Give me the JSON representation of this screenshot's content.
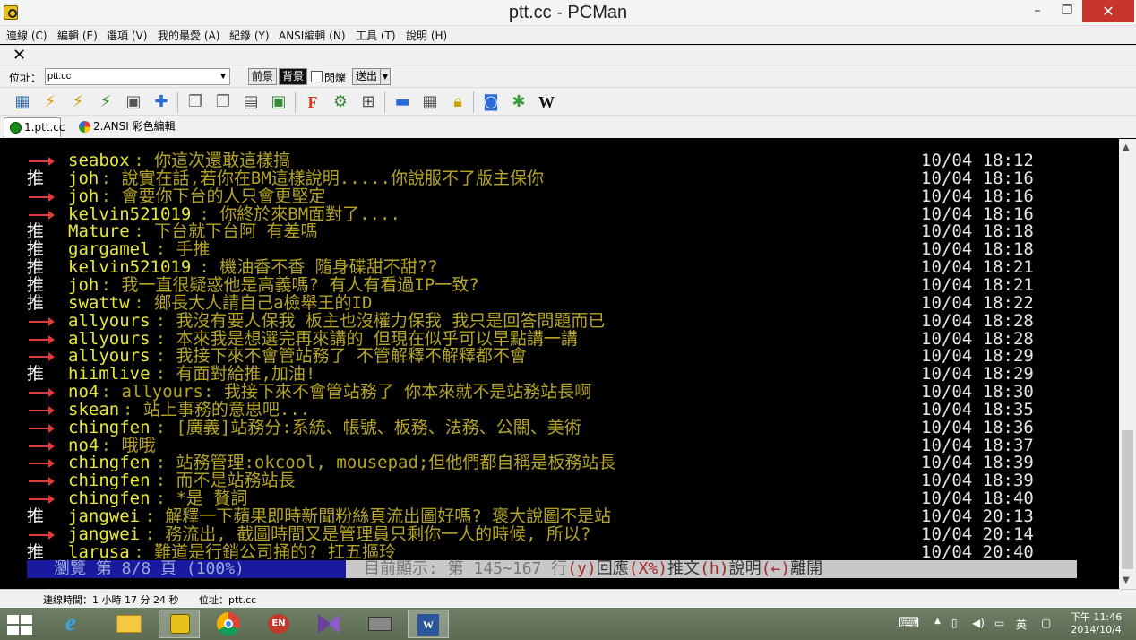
{
  "window": {
    "title": "ptt.cc - PCMan",
    "min": "–",
    "max": "❐",
    "close": "✕"
  },
  "menu": [
    "連線 (C)",
    "編輯 (E)",
    "選項 (V)",
    "我的最愛 (A)",
    "紀錄 (Y)",
    "ANSI編輯 (N)",
    "工具 (T)",
    "說明 (H)"
  ],
  "closebar": {
    "close_glyph": "✕"
  },
  "address": {
    "label": "位址：",
    "value": "ptt.cc",
    "fg_label": "前景",
    "bg_label": "背景",
    "blink_label": "閃爍",
    "send_label": "送出"
  },
  "toolbar": {
    "icons": [
      "address-book-icon",
      "connect-icon",
      "disconnect-icon",
      "reconnect-icon",
      "close-all-icon",
      "add-favorite-icon",
      "copy-icon",
      "paste-icon",
      "copy-ansi-icon",
      "screenshot-icon",
      "font-icon",
      "settings-icon",
      "layout-icon",
      "view-icon",
      "emoticons-icon",
      "lock-icon",
      "search-icon",
      "plugin-icon",
      "wikipedia-icon"
    ],
    "font_glyph": "F",
    "wiki_glyph": "W"
  },
  "tabs": [
    {
      "label": "1.ptt.cc",
      "active": true
    },
    {
      "label": "2.ANSI 彩色編輯",
      "active": false
    }
  ],
  "terminal": {
    "lines": [
      {
        "tag": "→",
        "user": "seabox",
        "text": ": 你這次還敢這樣搞",
        "time": "10/04 18:12"
      },
      {
        "tag": "推",
        "user": "joh",
        "text": ": 說實在話,若你在BM這樣說明.....你說服不了版主保你",
        "time": "10/04 18:16"
      },
      {
        "tag": "→",
        "user": "joh",
        "text": ": 會要你下台的人只會更堅定",
        "time": "10/04 18:16"
      },
      {
        "tag": "→",
        "user": "kelvin521019",
        "text": ": 你終於來BM面對了....",
        "time": "10/04 18:16"
      },
      {
        "tag": "推",
        "user": "Mature",
        "text": ": 下台就下台阿 有差嗎",
        "time": "10/04 18:18"
      },
      {
        "tag": "推",
        "user": "gargamel",
        "text": ": 手推",
        "time": "10/04 18:18"
      },
      {
        "tag": "推",
        "user": "kelvin521019",
        "text": ": 機油香不香  隨身碟甜不甜??",
        "time": "10/04 18:21"
      },
      {
        "tag": "推",
        "user": "joh",
        "text": ": 我一直很疑惑他是高義嗎? 有人有看過IP一致?",
        "time": "10/04 18:21"
      },
      {
        "tag": "推",
        "user": "swattw",
        "text": ": 鄉長大人請自己a檢舉王的ID",
        "time": "10/04 18:22"
      },
      {
        "tag": "→",
        "user": "allyours",
        "text": ": 我沒有要人保我 板主也沒權力保我 我只是回答問題而已",
        "time": "10/04 18:28"
      },
      {
        "tag": "→",
        "user": "allyours",
        "text": ": 本來我是想選完再來講的 但現在似乎可以早點講一講",
        "time": "10/04 18:28"
      },
      {
        "tag": "→",
        "user": "allyours",
        "text": ": 我接下來不會管站務了 不管解釋不解釋都不會",
        "time": "10/04 18:29"
      },
      {
        "tag": "推",
        "user": "hiimlive",
        "text": ": 有面對給推,加油!",
        "time": "10/04 18:29"
      },
      {
        "tag": "→",
        "user": "no4",
        "text": ": allyours: 我接下來不會管站務了   你本來就不是站務站長啊",
        "time": "10/04 18:30"
      },
      {
        "tag": "→",
        "user": "skean",
        "text": ": 站上事務的意思吧...",
        "time": "10/04 18:35"
      },
      {
        "tag": "→",
        "user": "chingfen",
        "text": ": [廣義]站務分:系統、帳號、板務、法務、公關、美術",
        "time": "10/04 18:36"
      },
      {
        "tag": "→",
        "user": "no4",
        "text": ": 哦哦",
        "time": "10/04 18:37"
      },
      {
        "tag": "→",
        "user": "chingfen",
        "text": ": 站務管理:okcool, mousepad;但他們都自稱是板務站長",
        "time": "10/04 18:39"
      },
      {
        "tag": "→",
        "user": "chingfen",
        "text": ":                                    而不是站務站長",
        "time": "10/04 18:39"
      },
      {
        "tag": "→",
        "user": "chingfen",
        "text": ":                                       *是 贅詞",
        "time": "10/04 18:40"
      },
      {
        "tag": "推",
        "user": "jangwei",
        "text": ": 解釋一下蘋果即時新聞粉絲頁流出圖好嗎? 褒大說圖不是站",
        "time": "10/04 20:13"
      },
      {
        "tag": "→",
        "user": "jangwei",
        "text": ": 務流出, 截圖時間又是管理員只剩你一人的時候, 所以?",
        "time": "10/04 20:14"
      },
      {
        "tag": "推",
        "user": "larusa",
        "text": ": 難道是行銷公司捅的?  扛五摳玲",
        "time": "10/04 20:40"
      }
    ],
    "status": {
      "left": "瀏覽 第 8/8 頁 (100%)",
      "range": "目前顯示: 第 145~167 行",
      "k1": "(y)",
      "w1": "回應",
      "k2": "(X%)",
      "w2": "推文",
      "k3": "(h)",
      "w3": "說明",
      "k4": "(←)",
      "w4": "離開"
    }
  },
  "scrollbar": {
    "up": "▲",
    "down": "▼"
  },
  "statusbar": {
    "conn_time": "連線時間：1 小時 17 分 24 秒",
    "addr": "位址：ptt.cc"
  },
  "taskbar": {
    "apps": [
      "internet-explorer-icon",
      "file-explorer-icon",
      "pcman-icon",
      "chrome-icon",
      "ime-en-icon",
      "visual-studio-icon",
      "network-tool-icon",
      "word-icon"
    ],
    "ie_glyph": "e",
    "en_glyph": "EN",
    "word_glyph": "W",
    "keyboard_glyph": "⌨",
    "tray_up": "▲",
    "volume_glyph": "◀)",
    "ime_glyph": "英",
    "time": "下午 11:46",
    "date": "2014/10/4"
  },
  "colors": {
    "terminal_bg": "#000000",
    "userid": "#e8e83a",
    "message": "#b5a426",
    "arrow": "#e03a3a",
    "push": "#ffffff",
    "timestamp": "#e6e6e6",
    "status_left_bg": "#1a1aa0",
    "status_right_bg": "#c8c8c8",
    "close_btn": "#c7332d"
  }
}
